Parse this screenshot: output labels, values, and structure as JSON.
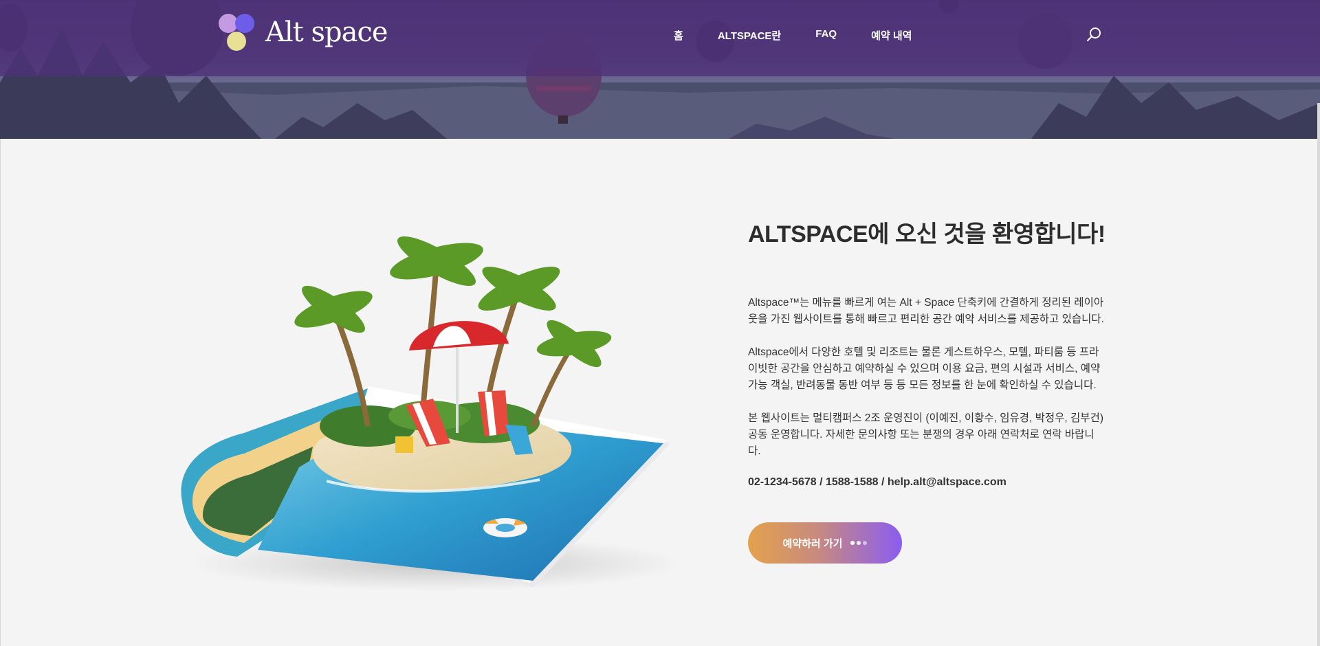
{
  "header": {
    "logo_text": "Alt space",
    "nav": [
      {
        "label": "홈"
      },
      {
        "label": "ALTSPACE란"
      },
      {
        "label": "FAQ"
      },
      {
        "label": "예약 내역"
      }
    ],
    "search_icon": "search-icon"
  },
  "main": {
    "title": "ALTSPACE에 오신 것을 환영합니다!",
    "paragraphs": [
      "Altspace™는 메뉴를 빠르게 여는 Alt + Space 단축키에 간결하게 정리된 레이아웃을 가진 웹사이트를 통해 빠르고 편리한 공간 예약 서비스를 제공하고 있습니다.",
      "Altspace에서 다양한 호텔 및 리조트는 물론 게스트하우스, 모텔, 파티룸 등 프라이빗한 공간을 안심하고 예약하실 수 있으며 이용 요금, 편의 시설과 서비스, 예약 가능 객실, 반려동물 동반 여부 등 등 모든 정보를 한 눈에 확인하실 수 있습니다.",
      "본 웹사이트는 멀티캠퍼스 2조 운영진이 (이예진, 이황수, 임유경, 박정우, 김부건) 공동 운영합니다. 자세한 문의사항 또는 분쟁의 경우 아래 연락처로 연락 바랍니다."
    ],
    "contact": "02-1234-5678 / 1588-1588 / help.alt@altspace.com",
    "cta_label": "예약하러 가기"
  },
  "colors": {
    "header_bg": "#4e3278",
    "cta_start": "#e3a24c",
    "cta_end": "#8a5df0",
    "page_bg": "#f4f4f4"
  }
}
